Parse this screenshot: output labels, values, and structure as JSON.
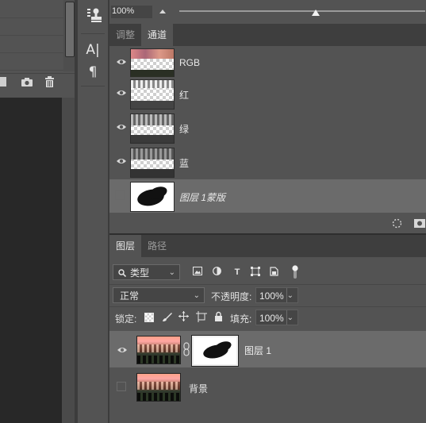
{
  "channels_panel": {
    "opacity_value": "100%",
    "tabs": [
      {
        "label": "调整",
        "active": false
      },
      {
        "label": "通道",
        "active": true
      }
    ],
    "channels": [
      {
        "label": "RGB",
        "visible": true,
        "selected": false
      },
      {
        "label": "红",
        "visible": true,
        "selected": false
      },
      {
        "label": "绿",
        "visible": true,
        "selected": false
      },
      {
        "label": "蓝",
        "visible": true,
        "selected": false
      },
      {
        "label": "图层 1蒙版",
        "visible": false,
        "selected": true
      }
    ]
  },
  "layers_panel": {
    "tabs": [
      {
        "label": "图层",
        "active": true
      },
      {
        "label": "路径",
        "active": false
      }
    ],
    "filter_kind": "类型",
    "blend_mode": "正常",
    "opacity_label": "不透明度:",
    "opacity_value": "100%",
    "lock_label": "锁定:",
    "fill_label": "填充:",
    "fill_value": "100%",
    "layers": [
      {
        "label": "图层 1",
        "visible": true,
        "selected": true,
        "has_mask": true
      },
      {
        "label": "背景",
        "visible": false,
        "selected": false,
        "has_mask": false
      }
    ]
  },
  "icons": {
    "visibility": "eye-icon",
    "link": "chain-link-icon",
    "search": "search-icon",
    "stamp": "stamp-tool-icon",
    "character": "character-panel-icon",
    "paragraph": "paragraph-panel-icon"
  },
  "colors": {
    "panel_bg": "#535353",
    "tab_bar_bg": "#3e3e3e",
    "selected_row_bg": "#6b6b6b",
    "canvas_bg": "#282828"
  }
}
